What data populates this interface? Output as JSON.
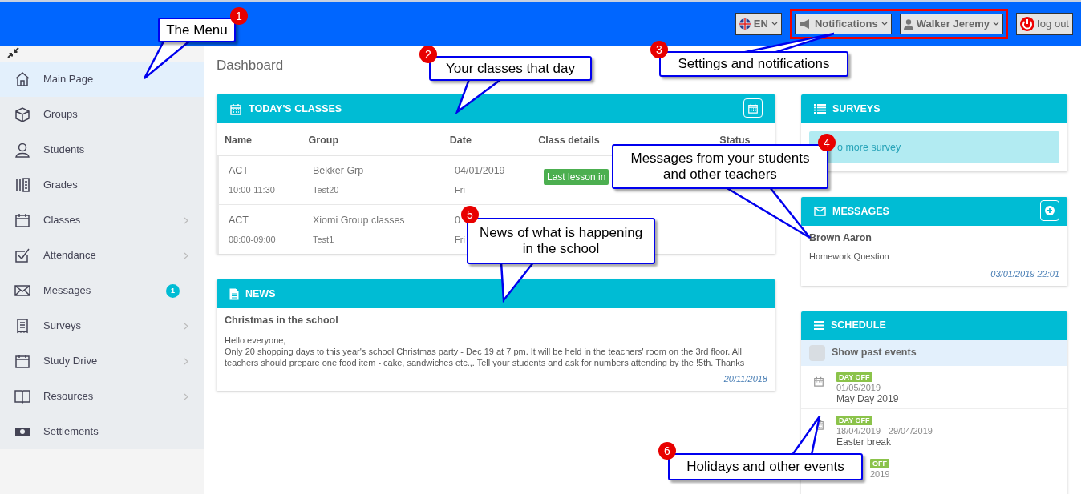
{
  "topbar": {
    "language": "EN",
    "notifications": "Notifications",
    "user": "Walker Jeremy",
    "logout": "log out"
  },
  "sidebar": {
    "items": [
      {
        "label": "Main Page",
        "selected": true,
        "submenu": false
      },
      {
        "label": "Groups",
        "selected": false,
        "submenu": false
      },
      {
        "label": "Students",
        "selected": false,
        "submenu": false
      },
      {
        "label": "Grades",
        "selected": false,
        "submenu": false
      },
      {
        "label": "Classes",
        "selected": false,
        "submenu": true
      },
      {
        "label": "Attendance",
        "selected": false,
        "submenu": true
      },
      {
        "label": "Messages",
        "selected": false,
        "submenu": false,
        "badge": "1"
      },
      {
        "label": "Surveys",
        "selected": false,
        "submenu": true
      },
      {
        "label": "Study Drive",
        "selected": false,
        "submenu": true
      },
      {
        "label": "Resources",
        "selected": false,
        "submenu": true
      },
      {
        "label": "Settlements",
        "selected": false,
        "submenu": false
      }
    ]
  },
  "page_title": "Dashboard",
  "classes": {
    "title": "TODAY'S CLASSES",
    "columns": [
      "Name",
      "Group",
      "Date",
      "Class details",
      "Status"
    ],
    "rows": [
      {
        "name": "ACT",
        "time": "10:00-11:30",
        "group": "Bekker Grp",
        "group_sub": "Test20",
        "date": "04/01/2019",
        "day": "Fri",
        "details": "Last lesson in"
      },
      {
        "name": "ACT",
        "time": "08:00-09:00",
        "group": "Xiomi Group classes",
        "group_sub": "Test1",
        "date": "0",
        "day": "Fri"
      }
    ]
  },
  "news": {
    "title": "NEWS",
    "items": [
      {
        "heading": "Christmas in the school",
        "body": "Hello everyone,\nOnly 20 shopping days to this year's school Christmas party - Dec 19 at 7 pm. It will be held in the teachers' room on the 3rd floor. All teachers should prepare one food item - cake, sandwiches etc.,. Tell your students and ask for numbers attending by the !5th. Thanks",
        "date": "20/11/2018"
      }
    ]
  },
  "surveys": {
    "title": "SURVEYS",
    "notice": "o more survey"
  },
  "messages": {
    "title": "MESSAGES",
    "items": [
      {
        "sender": "Brown Aaron",
        "subject": "Homework Question",
        "time": "03/01/2019 22:01"
      }
    ]
  },
  "schedule": {
    "title": "SCHEDULE",
    "show_past": {
      "label": "Show past events",
      "checked": false
    },
    "events": [
      {
        "tag": "DAY OFF",
        "date": "01/05/2019",
        "title": "May Day 2019"
      },
      {
        "tag": "DAY OFF",
        "date": "18/04/2019 - 29/04/2019",
        "title": "Easter break"
      },
      {
        "tag": "OFF",
        "date": "2019"
      }
    ]
  },
  "callouts": [
    {
      "number": "1",
      "text": "The Menu"
    },
    {
      "number": "2",
      "text": "Your classes that day"
    },
    {
      "number": "3",
      "text": "Settings and notifications"
    },
    {
      "number": "4",
      "text": "Messages from your students and other teachers"
    },
    {
      "number": "5",
      "text": "News of what is happening in the school"
    },
    {
      "number": "6",
      "text": "Holidays and other events"
    }
  ]
}
